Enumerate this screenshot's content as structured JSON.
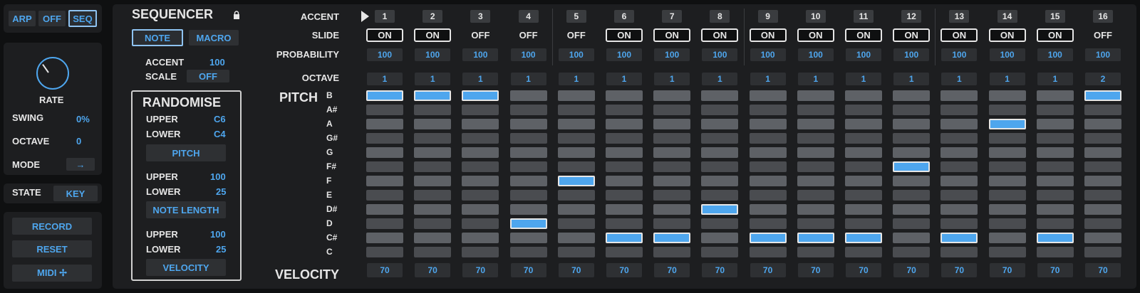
{
  "mode_buttons": {
    "arp": "ARP",
    "off": "OFF",
    "seq": "SEQ"
  },
  "left_controls": {
    "rate_label": "RATE",
    "swing_label": "SWING",
    "swing_value": "0%",
    "octave_label": "OCTAVE",
    "octave_value": "0",
    "mode_label": "MODE",
    "mode_value": "→"
  },
  "state": {
    "label": "STATE",
    "value": "KEY"
  },
  "actions": {
    "record": "RECORD",
    "reset": "RESET",
    "midi": "MIDI ✢"
  },
  "sequencer": {
    "title": "SEQUENCER",
    "note_tab": "NOTE",
    "macro_tab": "MACRO",
    "accent_label": "ACCENT",
    "accent_value": "100",
    "scale_label": "SCALE",
    "scale_value": "OFF"
  },
  "randomise": {
    "title": "RANDOMISE",
    "pitch": {
      "upper_label": "UPPER",
      "upper_value": "C6",
      "lower_label": "LOWER",
      "lower_value": "C4",
      "button": "PITCH"
    },
    "length": {
      "upper_label": "UPPER",
      "upper_value": "100",
      "lower_label": "LOWER",
      "lower_value": "25",
      "button": "NOTE LENGTH"
    },
    "velocity": {
      "upper_label": "UPPER",
      "upper_value": "100",
      "lower_label": "LOWER",
      "lower_value": "25",
      "button": "VELOCITY"
    }
  },
  "grid": {
    "row_labels": {
      "accent": "ACCENT",
      "slide": "SLIDE",
      "probability": "PROBABILITY",
      "octave": "OCTAVE",
      "pitch": "PITCH",
      "velocity": "VELOCITY"
    },
    "pitch_names": [
      "B",
      "A#",
      "A",
      "G#",
      "G",
      "F#",
      "F",
      "E",
      "D#",
      "D",
      "C#",
      "C"
    ],
    "steps": [
      {
        "num": "1",
        "slide": "ON",
        "prob": "100",
        "oct": "1",
        "pitch": "B",
        "vel": "70"
      },
      {
        "num": "2",
        "slide": "ON",
        "prob": "100",
        "oct": "1",
        "pitch": "B",
        "vel": "70"
      },
      {
        "num": "3",
        "slide": "OFF",
        "prob": "100",
        "oct": "1",
        "pitch": "B",
        "vel": "70"
      },
      {
        "num": "4",
        "slide": "OFF",
        "prob": "100",
        "oct": "1",
        "pitch": "D",
        "vel": "70"
      },
      {
        "num": "5",
        "slide": "OFF",
        "prob": "100",
        "oct": "1",
        "pitch": "F",
        "vel": "70"
      },
      {
        "num": "6",
        "slide": "ON",
        "prob": "100",
        "oct": "1",
        "pitch": "C#",
        "vel": "70"
      },
      {
        "num": "7",
        "slide": "ON",
        "prob": "100",
        "oct": "1",
        "pitch": "C#",
        "vel": "70"
      },
      {
        "num": "8",
        "slide": "ON",
        "prob": "100",
        "oct": "1",
        "pitch": "D#",
        "vel": "70"
      },
      {
        "num": "9",
        "slide": "ON",
        "prob": "100",
        "oct": "1",
        "pitch": "C#",
        "vel": "70"
      },
      {
        "num": "10",
        "slide": "ON",
        "prob": "100",
        "oct": "1",
        "pitch": "C#",
        "vel": "70"
      },
      {
        "num": "11",
        "slide": "ON",
        "prob": "100",
        "oct": "1",
        "pitch": "C#",
        "vel": "70"
      },
      {
        "num": "12",
        "slide": "ON",
        "prob": "100",
        "oct": "1",
        "pitch": "F#",
        "vel": "70"
      },
      {
        "num": "13",
        "slide": "ON",
        "prob": "100",
        "oct": "1",
        "pitch": "C#",
        "vel": "70"
      },
      {
        "num": "14",
        "slide": "ON",
        "prob": "100",
        "oct": "1",
        "pitch": "A",
        "vel": "70"
      },
      {
        "num": "15",
        "slide": "ON",
        "prob": "100",
        "oct": "1",
        "pitch": "C#",
        "vel": "70"
      },
      {
        "num": "16",
        "slide": "OFF",
        "prob": "100",
        "oct": "2",
        "pitch": "B",
        "vel": "70"
      }
    ]
  },
  "colors": {
    "accent": "#4ea6ee",
    "panel": "#1d1e20",
    "background": "#0f1011",
    "text": "#e6e6e6"
  },
  "icons": {
    "lock": "lock-icon",
    "playhead": "playhead-triangle-icon"
  }
}
